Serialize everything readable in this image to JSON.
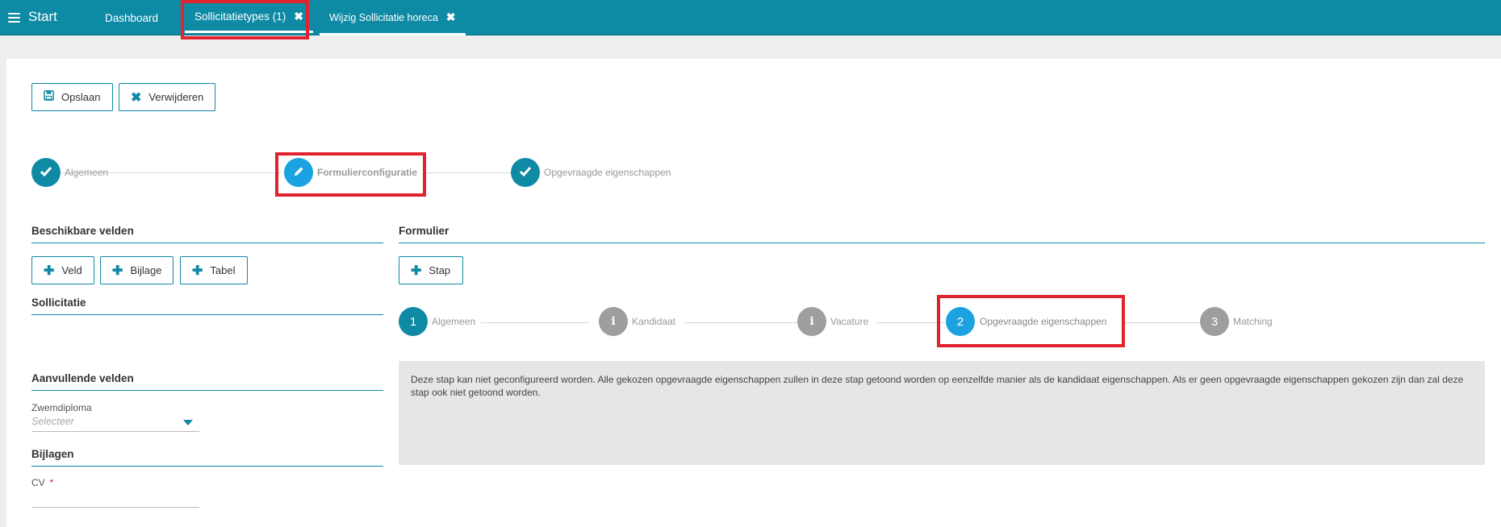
{
  "header": {
    "start_label": "Start",
    "tabs": [
      {
        "label": "Dashboard"
      },
      {
        "label": "Sollicitatietypes (1)",
        "close": "✖"
      },
      {
        "label": "Wijzig Sollicitatie horeca",
        "close": "✖"
      }
    ]
  },
  "toolbar": {
    "save_label": "Opslaan",
    "delete_label": "Verwijderen"
  },
  "wizard": {
    "steps": [
      {
        "label": "Algemeen",
        "state": "done"
      },
      {
        "label": "Formulierconfiguratie",
        "state": "active"
      },
      {
        "label": "Opgevraagde eigenschappen",
        "state": "done"
      }
    ]
  },
  "left": {
    "title": "Beschikbare velden",
    "buttons": [
      "Veld",
      "Bijlage",
      "Tabel"
    ],
    "sollicitatie_title": "Sollicitatie",
    "extra_title": "Aanvullende velden",
    "zwemdiploma_label": "Zwemdiploma",
    "zwemdiploma_placeholder": "Selecteer",
    "attachments_title": "Bijlagen",
    "cv_label": "CV",
    "cv_required": "*"
  },
  "right": {
    "title": "Formulier",
    "add_step_label": "Stap",
    "steps": [
      {
        "num": "1",
        "label": "Algemeen"
      },
      {
        "num": "i",
        "label": "Kandidaat"
      },
      {
        "num": "i",
        "label": "Vacature"
      },
      {
        "num": "2",
        "label": "Opgevraagde eigenschappen"
      },
      {
        "num": "3",
        "label": "Matching"
      }
    ],
    "info_text": "Deze stap kan niet geconfigureerd worden. Alle gekozen opgevraagde eigenschappen zullen in deze stap getoond worden op eenzelfde manier als de kandidaat eigenschappen. Als er geen opgevraagde eigenschappen gekozen zijn dan zal deze stap ook niet getoond worden."
  },
  "colors": {
    "accent": "#0f8aa5",
    "active_blue": "#1aa3e0",
    "inactive_grey": "#9e9e9e",
    "highlight_red": "#e12330"
  }
}
